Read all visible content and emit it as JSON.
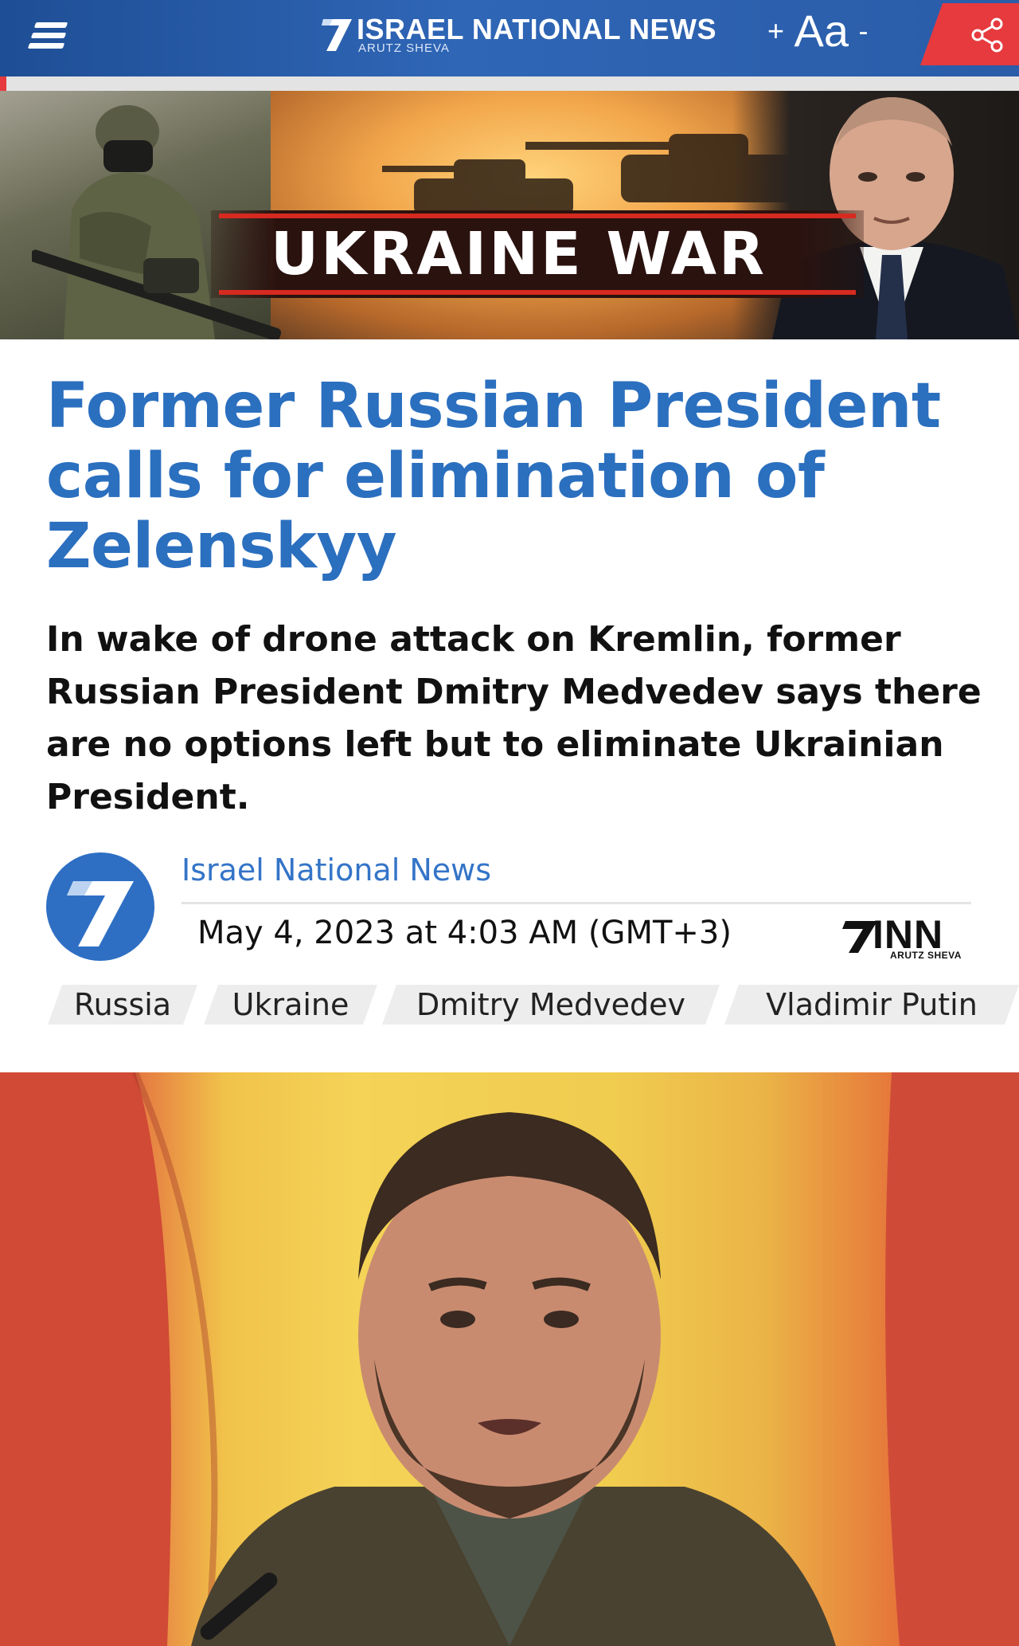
{
  "header": {
    "site_name": "ISRAEL NATIONAL NEWS",
    "site_subtitle": "ARUTZ SHEVA",
    "font_increase": "+",
    "font_label": "Aa",
    "font_decrease": "-"
  },
  "banner": {
    "title": "UKRAINE WAR"
  },
  "article": {
    "headline": "Former Russian President calls for elimination of Zelenskyy",
    "subheadline": "In wake of drone attack on Kremlin, former Russian President Dmitry Medvedev says there are no options left but to eliminate Ukrainian President."
  },
  "byline": {
    "author": "Israel National News",
    "date": "May 4, 2023 at 4:03 AM (GMT+3)",
    "brand": "INN",
    "brand_sub": "ARUTZ SHEVA"
  },
  "tags": [
    {
      "label": "Russia"
    },
    {
      "label": "Ukraine"
    },
    {
      "label": "Dmitry Medvedev"
    },
    {
      "label": "Vladimir Putin"
    }
  ],
  "colors": {
    "header_blue": "#2a5ca8",
    "share_red": "#e63a3e",
    "headline_blue": "#2b6fbf"
  },
  "icons": {
    "menu": "hamburger-icon",
    "share": "share-icon"
  }
}
